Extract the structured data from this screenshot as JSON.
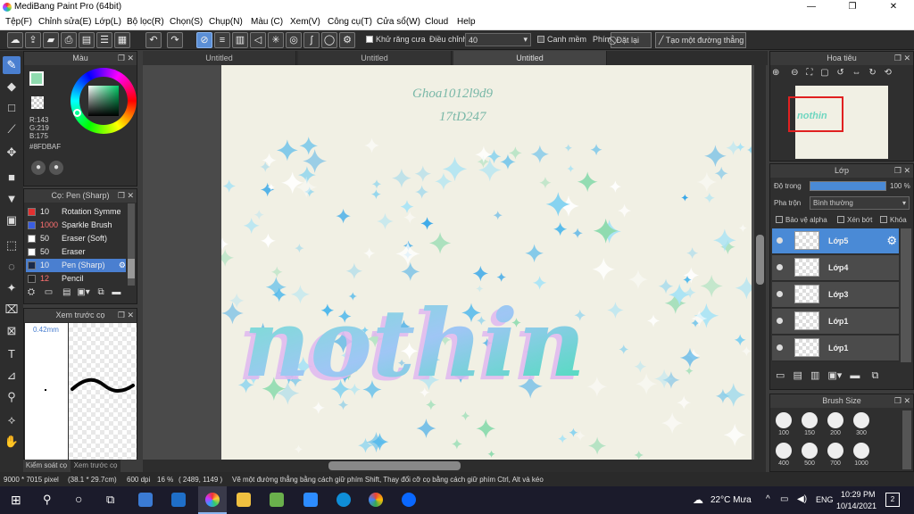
{
  "titlebar": {
    "title": "MediBang Paint Pro (64bit)",
    "min": "—",
    "max": "❐",
    "close": "✕"
  },
  "menu": [
    "Tệp(F)",
    "Chỉnh sửa(E)",
    "Lớp(L)",
    "Bộ lọc(R)",
    "Chọn(S)",
    "Chụp(N)",
    "Màu (C)",
    "Xem(V)",
    "Công cụ(T)",
    "Cửa sổ(W)",
    "Cloud",
    "Help"
  ],
  "toolbar": {
    "antialias": "Khử răng cưa",
    "correction_label": "Điều chỉnh",
    "correction_value": "40",
    "edge": "Canh mềm",
    "shortcut": "Phím",
    "reset": "Đặt lại",
    "straight": "Tạo một đường thẳng"
  },
  "color_panel": {
    "title": "Màu",
    "r": "R:143",
    "g": "G:219",
    "b": "B:175",
    "hex": "#8FDBAF",
    "accent": "#8FDBAF"
  },
  "brush_panel": {
    "title": "Cọ: Pen (Sharp)",
    "items": [
      {
        "size": "10",
        "name": "Rotation Symme",
        "color": "#e23030",
        "size_color": "#eeeeee"
      },
      {
        "size": "1000",
        "name": "Sparkle Brush",
        "color": "#3a5ee0",
        "size_color": "#ff7070"
      },
      {
        "size": "50",
        "name": "Eraser (Soft)",
        "color": "#ffffff",
        "size_color": "#eeeeee"
      },
      {
        "size": "50",
        "name": "Eraser",
        "color": "#ffffff",
        "size_color": "#eeeeee"
      },
      {
        "size": "10",
        "name": "Pen (Sharp)",
        "color": "#1a2a4a",
        "size_color": "#eeeeee"
      },
      {
        "size": "12",
        "name": "Pencil",
        "color": "#222222",
        "size_color": "#ff7070"
      }
    ]
  },
  "preview_panel": {
    "title": "Xem trước cọ",
    "size": "0.42mm"
  },
  "bottom_tabs": {
    "left": "Kiểm soát cọ",
    "right": "Xem trước cọ"
  },
  "tabs": [
    "Untitled",
    "Untitled",
    "Untitled"
  ],
  "canvas": {
    "handwriting1": "Ghoa1012l9d9",
    "handwriting2": "17tD247",
    "word": "nothin"
  },
  "navigator": {
    "title": "Hoa tiêu"
  },
  "layers_panel": {
    "title": "Lớp",
    "opacity_label": "Độ trong",
    "opacity_value": "100 %",
    "blend_label": "Pha trộn",
    "blend_value": "Bình thường",
    "protect_alpha": "Bảo vệ alpha",
    "clip": "Xén bớt",
    "lock": "Khóa",
    "layers": [
      {
        "name": "Lớp5",
        "selected": true
      },
      {
        "name": "Lớp4",
        "selected": false
      },
      {
        "name": "Lớp3",
        "selected": false
      },
      {
        "name": "Lớp1",
        "selected": false
      },
      {
        "name": "Lớp1",
        "selected": false
      }
    ]
  },
  "brush_size": {
    "title": "Brush Size",
    "sizes": [
      "100",
      "150",
      "200",
      "300",
      "400",
      "500",
      "700",
      "1000"
    ]
  },
  "status": {
    "dims": "9000 * 7015 pixel",
    "cm": "(38.1 * 29.7cm)",
    "dpi": "600 dpi",
    "zoom": "16 %",
    "coords": "( 2489, 1149 )",
    "hint": "Vẽ một đường thẳng bằng cách giữ phím Shift, Thay đổi cỡ cọ bằng cách giữ phím Ctrl, Alt và kéo"
  },
  "taskbar": {
    "weather": "22°C Mưa",
    "lang": "ENG",
    "time": "10:29 PM",
    "date": "10/14/2021",
    "notif": "2"
  }
}
